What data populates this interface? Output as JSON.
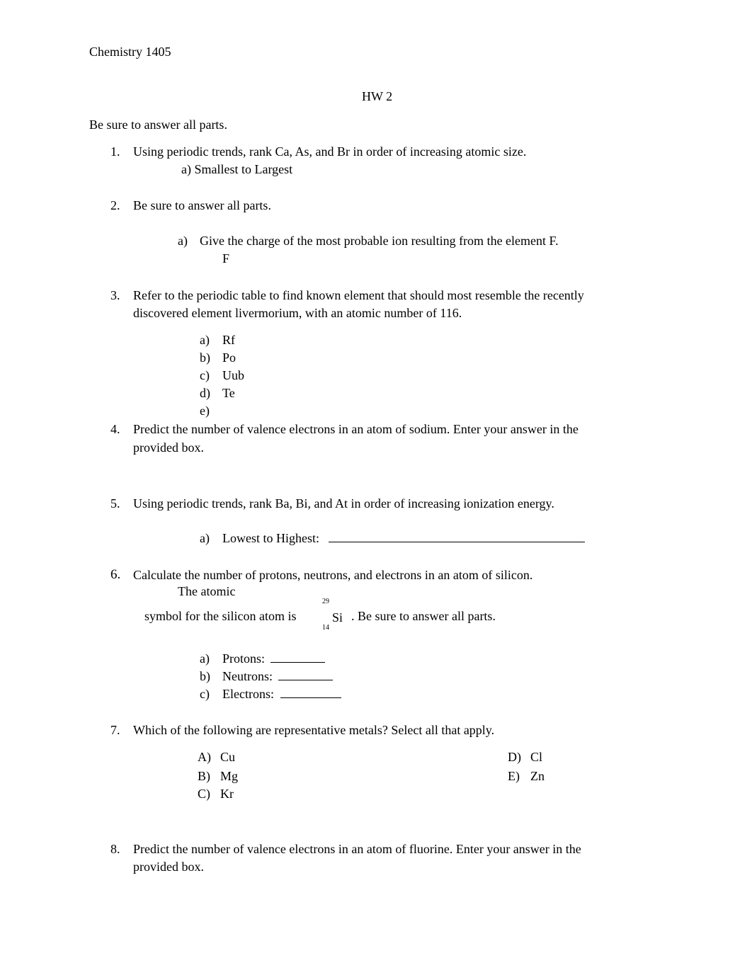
{
  "header": {
    "course": "Chemistry 1405",
    "title": "HW 2",
    "instruction": "Be sure to answer all parts."
  },
  "questions": [
    {
      "number": "1.",
      "text": "Using periodic trends, rank Ca, As, and Br in order of increasing atomic size.",
      "sub": "a) Smallest to Largest"
    },
    {
      "number": "2.",
      "text": "Be sure to answer all parts.",
      "part_label": "a)",
      "part_text": "Give the charge of the most probable ion resulting from the element F.",
      "answer_element": "F"
    },
    {
      "number": "3.",
      "text_line1": "Refer to the periodic table to find known element that should most resemble the recently",
      "text_line2": "discovered element livermorium, with an atomic number of 116.",
      "options": [
        {
          "label": "a)",
          "text": "Rf"
        },
        {
          "label": "b)",
          "text": "Po"
        },
        {
          "label": "c)",
          "text": "Uub"
        },
        {
          "label": "d)",
          "text": "Te"
        },
        {
          "label": "e)",
          "text": ""
        }
      ]
    },
    {
      "number": "4.",
      "text_line1": "Predict the number of valence electrons in an atom of sodium. Enter your answer in the",
      "text_line2": "provided box."
    },
    {
      "number": "5.",
      "text": "Using periodic trends, rank Ba, Bi, and At in order of increasing ionization energy.",
      "part_label": "a)",
      "part_text": "Lowest to Highest:"
    },
    {
      "number": "6.",
      "text": "Calculate the number of protons, neutrons, and electrons in an atom of silicon.",
      "text_line2": "The atomic",
      "text_line3_pre": "symbol for the silicon atom is",
      "mass_number": "29",
      "element_symbol": "Si",
      "atomic_number": "14",
      "text_line3_post": ". Be sure to answer all parts.",
      "parts": [
        {
          "label": "a)",
          "text": "Protons:"
        },
        {
          "label": "b)",
          "text": "Neutrons:"
        },
        {
          "label": "c)",
          "text": "Electrons:"
        }
      ]
    },
    {
      "number": "7.",
      "text": "Which of the following are representative metals? Select all that apply.",
      "options_left": [
        {
          "label": "A)",
          "text": "Cu"
        },
        {
          "label": "B)",
          "text": "Mg"
        },
        {
          "label": "C)",
          "text": "Kr"
        }
      ],
      "options_right": [
        {
          "label": "D)",
          "text": "Cl"
        },
        {
          "label": "E)",
          "text": "Zn"
        }
      ]
    },
    {
      "number": "8.",
      "text_line1": "Predict the number of valence electrons in an atom of fluorine. Enter your answer in the",
      "text_line2": "provided box."
    }
  ]
}
